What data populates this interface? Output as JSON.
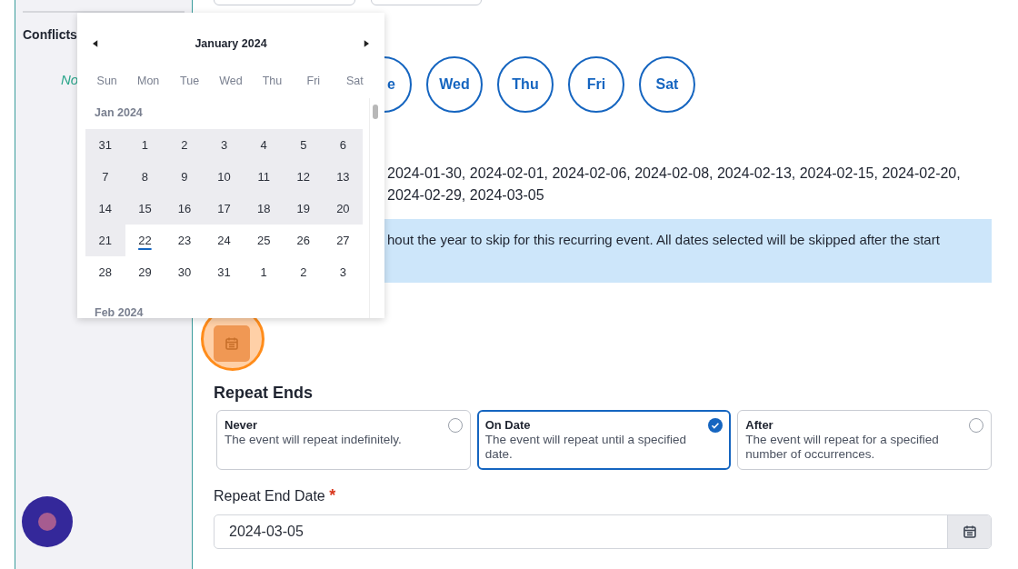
{
  "sidebar": {
    "heading": "Conflicts",
    "empty_text": "No"
  },
  "weekday_buttons": [
    {
      "label": "e",
      "selected": false
    },
    {
      "label": "Wed",
      "selected": false
    },
    {
      "label": "Thu",
      "selected": false
    },
    {
      "label": "Fri",
      "selected": false
    },
    {
      "label": "Sat",
      "selected": false
    }
  ],
  "skip_dates_lines": [
    "2024-01-30, 2024-02-01, 2024-02-06, 2024-02-08, 2024-02-13, 2024-02-15, 2024-02-20,",
    "2024-02-29, 2024-03-05"
  ],
  "info_banner": {
    "text": "hout the year to skip for this recurring event. All dates selected will be skipped after the start"
  },
  "repeat_ends": {
    "heading": "Repeat Ends",
    "options": [
      {
        "title": "Never",
        "description": "The event will repeat indefinitely.",
        "selected": false
      },
      {
        "title": "On Date",
        "description": "The event will repeat until a specified date.",
        "selected": true
      },
      {
        "title": "After",
        "description": "The event will repeat for a specified number of occurrences.",
        "selected": false
      }
    ]
  },
  "end_date": {
    "label": "Repeat End Date",
    "required": true,
    "required_mark": "*",
    "value": "2024-03-05"
  },
  "datepicker": {
    "title": "January 2024",
    "weekdays": [
      "Sun",
      "Mon",
      "Tue",
      "Wed",
      "Thu",
      "Fri",
      "Sat"
    ],
    "months": [
      {
        "label": "Jan 2024",
        "weeks": [
          [
            {
              "day": "31",
              "in_range": true,
              "today": false
            },
            {
              "day": "1",
              "in_range": true,
              "today": false
            },
            {
              "day": "2",
              "in_range": true,
              "today": false
            },
            {
              "day": "3",
              "in_range": true,
              "today": false
            },
            {
              "day": "4",
              "in_range": true,
              "today": false
            },
            {
              "day": "5",
              "in_range": true,
              "today": false
            },
            {
              "day": "6",
              "in_range": true,
              "today": false
            }
          ],
          [
            {
              "day": "7",
              "in_range": true,
              "today": false
            },
            {
              "day": "8",
              "in_range": true,
              "today": false
            },
            {
              "day": "9",
              "in_range": true,
              "today": false
            },
            {
              "day": "10",
              "in_range": true,
              "today": false
            },
            {
              "day": "11",
              "in_range": true,
              "today": false
            },
            {
              "day": "12",
              "in_range": true,
              "today": false
            },
            {
              "day": "13",
              "in_range": true,
              "today": false
            }
          ],
          [
            {
              "day": "14",
              "in_range": true,
              "today": false
            },
            {
              "day": "15",
              "in_range": true,
              "today": false
            },
            {
              "day": "16",
              "in_range": true,
              "today": false
            },
            {
              "day": "17",
              "in_range": true,
              "today": false
            },
            {
              "day": "18",
              "in_range": true,
              "today": false
            },
            {
              "day": "19",
              "in_range": true,
              "today": false
            },
            {
              "day": "20",
              "in_range": true,
              "today": false
            }
          ],
          [
            {
              "day": "21",
              "in_range": true,
              "today": false
            },
            {
              "day": "22",
              "in_range": false,
              "today": true
            },
            {
              "day": "23",
              "in_range": false,
              "today": false
            },
            {
              "day": "24",
              "in_range": false,
              "today": false
            },
            {
              "day": "25",
              "in_range": false,
              "today": false
            },
            {
              "day": "26",
              "in_range": false,
              "today": false
            },
            {
              "day": "27",
              "in_range": false,
              "today": false
            }
          ],
          [
            {
              "day": "28",
              "in_range": false,
              "today": false
            },
            {
              "day": "29",
              "in_range": false,
              "today": false
            },
            {
              "day": "30",
              "in_range": false,
              "today": false
            },
            {
              "day": "31",
              "in_range": false,
              "today": false
            },
            {
              "day": "1",
              "in_range": false,
              "today": false
            },
            {
              "day": "2",
              "in_range": false,
              "today": false
            },
            {
              "day": "3",
              "in_range": false,
              "today": false
            }
          ]
        ]
      },
      {
        "label": "Feb 2024"
      }
    ]
  }
}
